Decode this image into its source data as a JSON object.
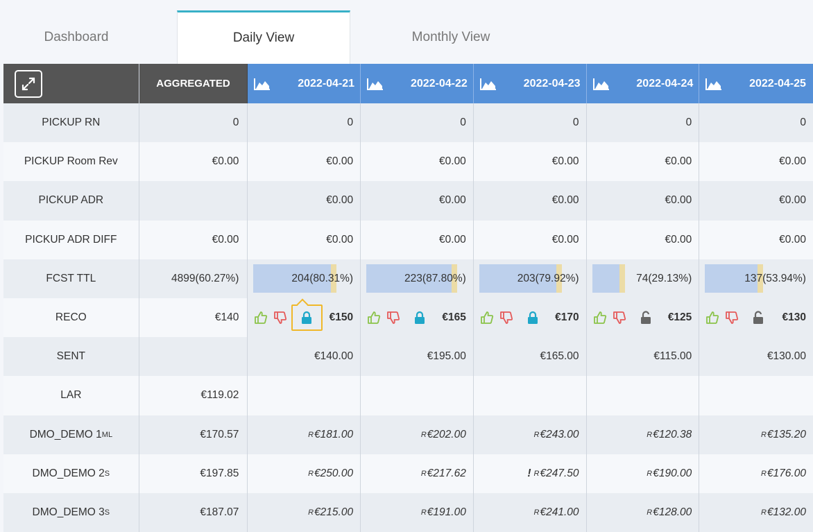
{
  "tabs": [
    {
      "label": "Dashboard",
      "active": false
    },
    {
      "label": "Daily View",
      "active": true
    },
    {
      "label": "Monthly View",
      "active": false
    }
  ],
  "colors": {
    "header_blue": "#5590d8",
    "header_dark": "#555555",
    "accent_tab": "#38b0c7",
    "lock_blue": "#1fa7c9",
    "thumb_up": "#8bc34a",
    "thumb_down": "#e55a5a",
    "highlight": "#f0b82a"
  },
  "header": {
    "expand_icon": "expand-arrows-icon",
    "aggregated": "AGGREGATED",
    "dates": [
      "2022-04-21",
      "2022-04-22",
      "2022-04-23",
      "2022-04-24",
      "2022-04-25"
    ]
  },
  "rows": {
    "pickup_rn": {
      "label": "PICKUP RN",
      "agg": "0",
      "days": [
        "0",
        "0",
        "0",
        "0",
        "0"
      ]
    },
    "pickup_room_rev": {
      "label": "PICKUP Room Rev",
      "agg": "€0.00",
      "days": [
        "€0.00",
        "€0.00",
        "€0.00",
        "€0.00",
        "€0.00"
      ]
    },
    "pickup_adr": {
      "label": "PICKUP ADR",
      "agg": "",
      "days": [
        "€0.00",
        "€0.00",
        "€0.00",
        "€0.00",
        "€0.00"
      ]
    },
    "pickup_adr_diff": {
      "label": "PICKUP ADR DIFF",
      "agg": "€0.00",
      "days": [
        "€0.00",
        "€0.00",
        "€0.00",
        "€0.00",
        "€0.00"
      ]
    },
    "fcst_ttl": {
      "label": "FCST TTL",
      "agg": "4899(60.27%)",
      "days": [
        "204(80.31%)",
        "223(87.80%)",
        "203(79.92%)",
        "74(29.13%)",
        "137(53.94%)"
      ],
      "fill_pct": [
        80.31,
        87.8,
        79.92,
        29.13,
        53.94
      ]
    },
    "reco": {
      "label": "RECO",
      "agg": "€140",
      "days": [
        "€150",
        "€165",
        "€170",
        "€125",
        "€130"
      ],
      "locked": [
        true,
        true,
        true,
        false,
        false
      ]
    },
    "sent": {
      "label": "SENT",
      "agg": "",
      "days": [
        "€140.00",
        "€195.00",
        "€165.00",
        "€115.00",
        "€130.00"
      ]
    },
    "lar": {
      "label": "LAR",
      "agg": "€119.02",
      "days": [
        "",
        "",
        "",
        "",
        ""
      ]
    },
    "dmo1": {
      "label": "DMO_DEMO 1",
      "sup": "ML",
      "agg": "€170.57",
      "prefix": "R",
      "days": [
        "€181.00",
        "€202.00",
        "€243.00",
        "€120.38",
        "€135.20"
      ]
    },
    "dmo2": {
      "label": "DMO_DEMO 2",
      "sup": "S",
      "agg": "€197.85",
      "prefix": "R",
      "days": [
        "€250.00",
        "€217.62",
        "€247.50",
        "€190.00",
        "€176.00"
      ],
      "warning": "!"
    },
    "dmo3": {
      "label": "DMO_DEMO 3",
      "sup": "S",
      "agg": "€187.07",
      "prefix": "R",
      "days": [
        "€215.00",
        "€191.00",
        "€241.00",
        "€128.00",
        "€132.00"
      ]
    }
  }
}
